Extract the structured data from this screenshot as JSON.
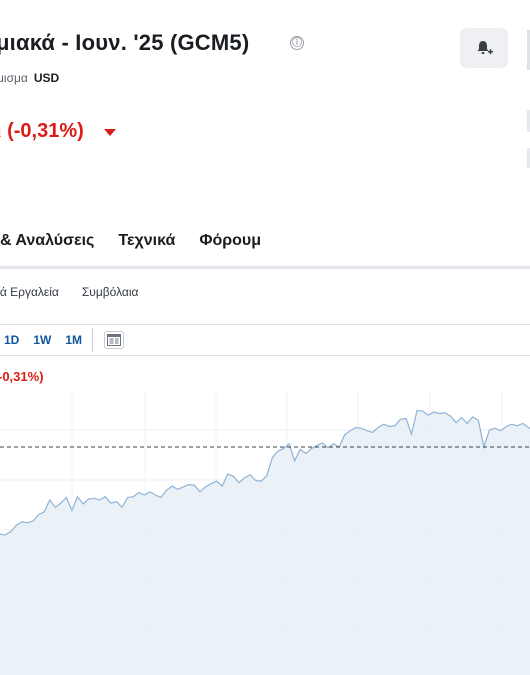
{
  "header": {
    "title": "μιακά - Ιουν. '25 (GCM5)",
    "info_icon": "ⓘ",
    "currency_label": "μισμα",
    "currency_value": "USD",
    "alert_icon": "bell-plus-icon"
  },
  "price": {
    "change": "ι (-0,31%)",
    "direction": "down",
    "color": "#d91e18"
  },
  "tabs": [
    {
      "label": "& Αναλύσεις"
    },
    {
      "label": "Τεχνικά"
    },
    {
      "label": "Φόρουμ"
    }
  ],
  "subtabs": [
    {
      "label": "κά Εργαλεία"
    },
    {
      "label": "Συμβόλαια"
    }
  ],
  "chart_toolbar": {
    "periods": [
      "1D",
      "1W",
      "1M"
    ],
    "chart_type_icon": "candlestick-chart-icon",
    "accent": "#1256a0"
  },
  "chart_overlay": {
    "change": "-0,31%)"
  },
  "chart_data": {
    "type": "area",
    "line_color": "#8fb4d6",
    "fill_color": "#e6eef6",
    "grid": true,
    "reference_line": "dashed",
    "values": [
      17.6,
      17.3,
      17.2,
      17.6,
      18.4,
      18.8,
      18.7,
      18.9,
      19.7,
      20.0,
      21.5,
      20.6,
      21.1,
      21.8,
      20.2,
      21.9,
      21.0,
      21.6,
      21.7,
      21.5,
      21.9,
      21.1,
      21.3,
      20.6,
      21.8,
      21.9,
      22.4,
      22.1,
      22.5,
      22.1,
      21.8,
      22.7,
      23.2,
      22.8,
      23.1,
      23.4,
      23.3,
      22.5,
      23.1,
      23.5,
      23.8,
      23.2,
      24.7,
      24.4,
      23.6,
      24.2,
      24.6,
      23.9,
      23.8,
      24.5,
      26.7,
      27.5,
      27.8,
      28.4,
      26.3,
      27.7,
      27.2,
      27.8,
      28.2,
      28.5,
      27.9,
      28.4,
      28.0,
      29.5,
      30.0,
      30.4,
      30.3,
      30.0,
      29.8,
      30.4,
      30.8,
      30.5,
      30.6,
      31.4,
      31.5,
      29.6,
      32.5,
      32.4,
      31.9,
      32.3,
      32.1,
      32.2,
      31.8,
      31.0,
      31.6,
      30.9,
      31.7,
      31.3,
      28.0,
      30.1,
      30.3,
      30.0,
      30.5,
      30.8,
      30.6,
      30.9,
      30.4,
      30.1
    ],
    "reference_value": 28.0
  }
}
